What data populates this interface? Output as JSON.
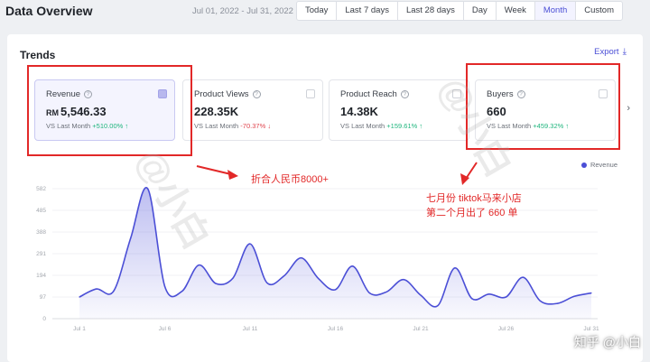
{
  "header": {
    "title": "Data Overview",
    "date_range": "Jul 01, 2022 - Jul 31, 2022",
    "tabs": [
      {
        "label": "Today",
        "active": false
      },
      {
        "label": "Last 7 days",
        "active": false
      },
      {
        "label": "Last 28 days",
        "active": false
      },
      {
        "label": "Day",
        "active": false
      },
      {
        "label": "Week",
        "active": false
      },
      {
        "label": "Month",
        "active": true
      },
      {
        "label": "Custom",
        "active": false
      }
    ]
  },
  "trends": {
    "title": "Trends",
    "export_label": "Export",
    "metrics": [
      {
        "label": "Revenue",
        "currency": "RM",
        "value": "5,546.33",
        "compare_label": "VS Last Month",
        "change": "+510.00%",
        "direction": "up",
        "selected": true
      },
      {
        "label": "Product Views",
        "currency": "",
        "value": "228.35K",
        "compare_label": "VS Last Month",
        "change": "-70.37%",
        "direction": "down",
        "selected": false
      },
      {
        "label": "Product Reach",
        "currency": "",
        "value": "14.38K",
        "compare_label": "VS Last Month",
        "change": "+159.61%",
        "direction": "up",
        "selected": false
      },
      {
        "label": "Buyers",
        "currency": "",
        "value": "660",
        "compare_label": "VS Last Month",
        "change": "+459.32%",
        "direction": "up",
        "selected": false
      }
    ],
    "legend_label": "Revenue"
  },
  "annotations": {
    "rmb_note": "折合人民币8000+",
    "buyers_note_line1": "七月份 tiktok马来小店",
    "buyers_note_line2": "第二个月出了 660 单"
  },
  "watermark_text": "@小白",
  "corner_watermark": "知乎 @小白",
  "colors": {
    "accent": "#4b4fd6",
    "annotation": "#e22828",
    "up": "#1fb57d",
    "down": "#e0464f"
  },
  "chart_data": {
    "type": "area",
    "series": [
      {
        "name": "Revenue",
        "values": [
          97,
          133,
          123,
          360,
          582,
          145,
          122,
          240,
          157,
          182,
          335,
          160,
          192,
          272,
          180,
          130,
          235,
          115,
          120,
          175,
          105,
          58,
          227,
          90,
          110,
          97,
          185,
          80,
          68,
          100,
          115
        ]
      }
    ],
    "x": [
      1,
      2,
      3,
      4,
      5,
      6,
      7,
      8,
      9,
      10,
      11,
      12,
      13,
      14,
      15,
      16,
      17,
      18,
      19,
      20,
      21,
      22,
      23,
      24,
      25,
      26,
      27,
      28,
      29,
      30,
      31
    ],
    "x_tick_labels": [
      "Jul 1",
      "Jul 6",
      "Jul 11",
      "Jul 16",
      "Jul 21",
      "Jul 26",
      "Jul 31"
    ],
    "x_tick_positions": [
      1,
      6,
      11,
      16,
      21,
      26,
      31
    ],
    "y_ticks": [
      "0",
      "97",
      "194",
      "291",
      "388",
      "485",
      "582"
    ],
    "y_tick_values": [
      0,
      97,
      194,
      291,
      388,
      485,
      582
    ],
    "ylim": [
      0,
      582
    ],
    "grid": "horizontal"
  }
}
